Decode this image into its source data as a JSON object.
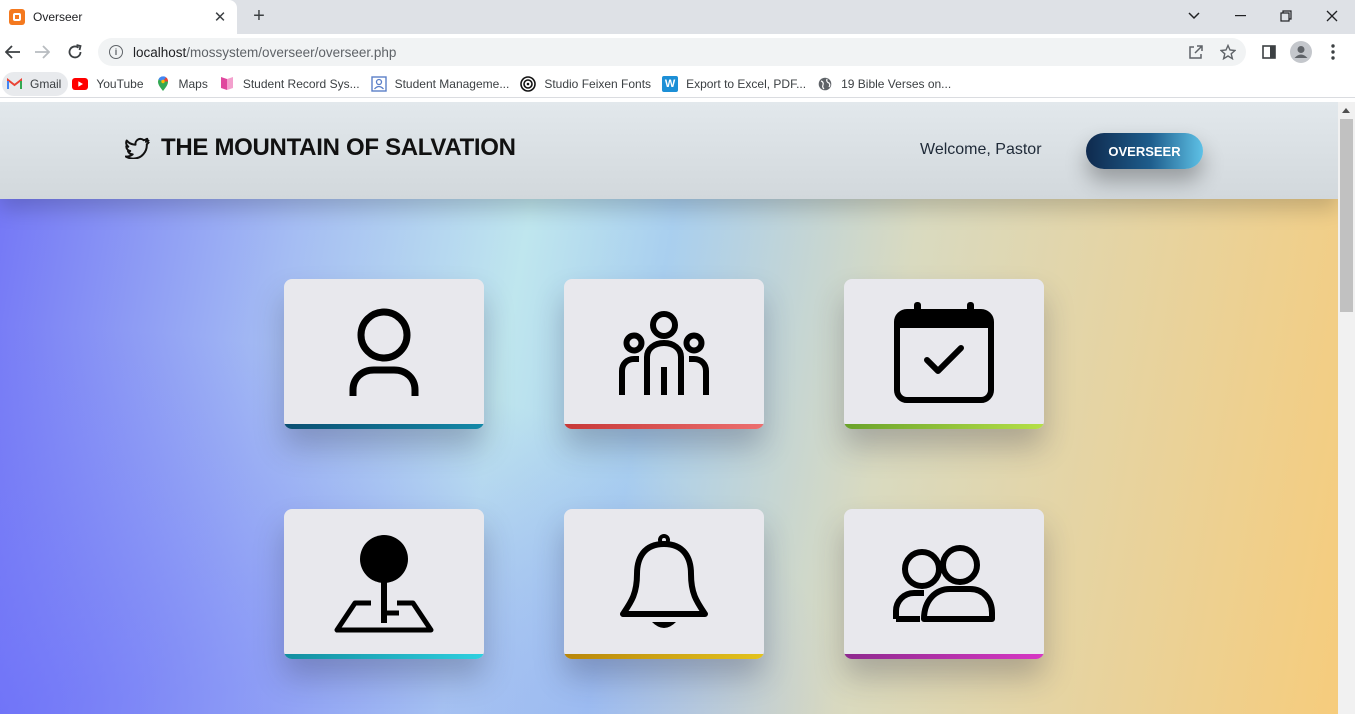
{
  "browser": {
    "tab_title": "Overseer",
    "new_tab": "+",
    "url_host": "localhost",
    "url_path": "/mossystem/overseer/overseer.php",
    "bookmarks": [
      {
        "label": "Gmail"
      },
      {
        "label": "YouTube"
      },
      {
        "label": "Maps"
      },
      {
        "label": "Student Record Sys..."
      },
      {
        "label": "Student Manageme..."
      },
      {
        "label": "Studio Feixen Fonts"
      },
      {
        "label": "Export to Excel, PDF..."
      },
      {
        "label": "19 Bible Verses on..."
      }
    ]
  },
  "header": {
    "site_title": "THE MOUNTAIN OF SALVATION",
    "welcome": "Welcome, Pastor",
    "role_button": "OVERSEER"
  },
  "cards": [
    {
      "icon": "user-icon",
      "accent": "#0d6a8f"
    },
    {
      "icon": "group-icon",
      "accent": "#e05a5a"
    },
    {
      "icon": "calendar-check-icon",
      "accent": "#8fc73e"
    },
    {
      "icon": "location-pin-icon",
      "accent": "#22b3c6"
    },
    {
      "icon": "bell-icon",
      "accent": "#c9a01a"
    },
    {
      "icon": "users-icon",
      "accent": "#b03aa8"
    }
  ]
}
